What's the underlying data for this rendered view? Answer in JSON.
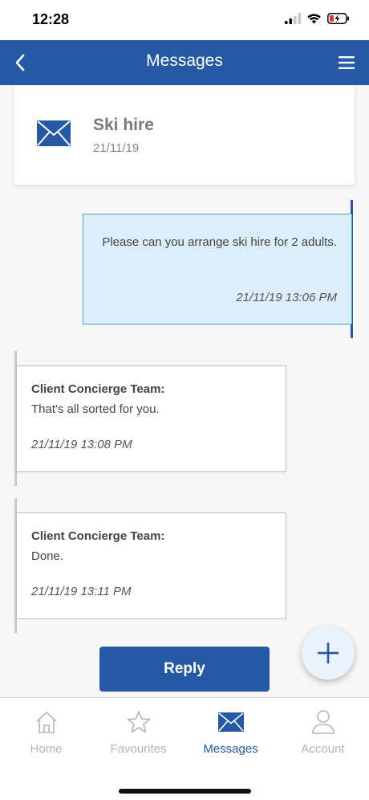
{
  "status_bar": {
    "time": "12:28"
  },
  "nav": {
    "title": "Messages",
    "back_icon": "chevron-left-icon",
    "menu_icon": "hamburger-menu-icon"
  },
  "thread": {
    "subject": "Ski hire",
    "date": "21/11/19",
    "icon": "envelope-icon"
  },
  "messages": [
    {
      "direction": "outgoing",
      "text": "Please can you arrange ski hire for 2 adults.",
      "timestamp": "21/11/19 13:06 PM"
    },
    {
      "direction": "incoming",
      "sender": "Client Concierge Team:",
      "text": "That's all sorted for you.",
      "timestamp": "21/11/19 13:08 PM"
    },
    {
      "direction": "incoming",
      "sender": "Client Concierge Team:",
      "text": "Done.",
      "timestamp": "21/11/19 13:11 PM"
    }
  ],
  "actions": {
    "reply_label": "Reply",
    "fab_icon": "plus-icon"
  },
  "tabs": [
    {
      "label": "Home",
      "icon": "home-icon",
      "active": false
    },
    {
      "label": "Favourites",
      "icon": "star-icon",
      "active": false
    },
    {
      "label": "Messages",
      "icon": "envelope-icon",
      "active": true
    },
    {
      "label": "Account",
      "icon": "user-icon",
      "active": false
    }
  ],
  "colors": {
    "brand_blue": "#2559a6",
    "outgoing_bubble": "#dbeefa",
    "inactive_tab": "#b5b5b5"
  }
}
